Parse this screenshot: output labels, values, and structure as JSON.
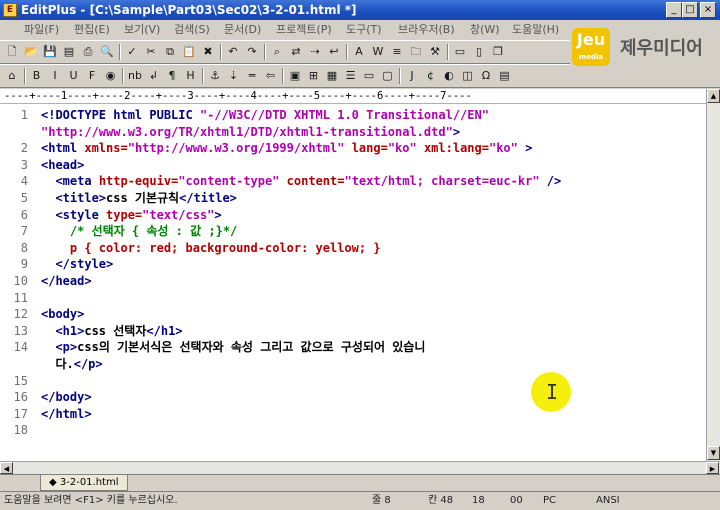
{
  "window": {
    "title": "EditPlus - [C:\\Sample\\Part03\\Sec02\\3-2-01.html *]",
    "min_label": "_",
    "max_label": "□",
    "close_label": "×"
  },
  "menu": [
    "파일(F)",
    "편집(E)",
    "보기(V)",
    "검색(S)",
    "문서(D)",
    "프로젝트(P)",
    "도구(T)",
    "브라우저(B)",
    "창(W)",
    "도움말(H)"
  ],
  "logo": {
    "mark": "Jeu",
    "mark_sub": "media",
    "name": "제우미디어"
  },
  "toolbar1": [
    {
      "name": "new-file-icon",
      "glyph": "🗋"
    },
    {
      "name": "open-icon",
      "glyph": "📂"
    },
    {
      "name": "save-icon",
      "glyph": "💾"
    },
    {
      "name": "save-all-icon",
      "glyph": "▤"
    },
    {
      "name": "print-icon",
      "glyph": "⎙"
    },
    {
      "name": "preview-icon",
      "glyph": "🔍"
    },
    {
      "name": "spell-check-icon",
      "glyph": "✓"
    },
    {
      "name": "cut-icon",
      "glyph": "✂"
    },
    {
      "name": "copy-icon",
      "glyph": "⧉"
    },
    {
      "name": "paste-icon",
      "glyph": "📋"
    },
    {
      "name": "delete-icon",
      "glyph": "✖"
    },
    {
      "name": "undo-icon",
      "glyph": "↶"
    },
    {
      "name": "redo-icon",
      "glyph": "↷"
    },
    {
      "name": "find-icon",
      "glyph": "⌕"
    },
    {
      "name": "replace-icon",
      "glyph": "⇄"
    },
    {
      "name": "goto-icon",
      "glyph": "⇢"
    },
    {
      "name": "word-wrap-icon",
      "glyph": "↩"
    },
    {
      "name": "font-icon",
      "glyph": "A"
    },
    {
      "name": "browser-icon",
      "glyph": "W"
    },
    {
      "name": "cliptext-icon",
      "glyph": "≡"
    },
    {
      "name": "directory-icon",
      "glyph": "🗀"
    },
    {
      "name": "user-tool-icon",
      "glyph": "⚒"
    },
    {
      "name": "tile-h-icon",
      "glyph": "▭"
    },
    {
      "name": "tile-v-icon",
      "glyph": "▯"
    },
    {
      "name": "cascade-icon",
      "glyph": "❐"
    }
  ],
  "toolbar2": [
    {
      "name": "quick-html-icon",
      "glyph": "⌂"
    },
    {
      "name": "bold-icon",
      "glyph": "B"
    },
    {
      "name": "italic-icon",
      "glyph": "I"
    },
    {
      "name": "underline-icon",
      "glyph": "U"
    },
    {
      "name": "font-tag-icon",
      "glyph": "F"
    },
    {
      "name": "color-icon",
      "glyph": "◉"
    },
    {
      "name": "nbsp-icon",
      "glyph": "nb"
    },
    {
      "name": "br-icon",
      "glyph": "↲"
    },
    {
      "name": "paragraph-icon",
      "glyph": "¶"
    },
    {
      "name": "heading-icon",
      "glyph": "H"
    },
    {
      "name": "anchor-icon",
      "glyph": "⚓"
    },
    {
      "name": "link-icon",
      "glyph": "⇣"
    },
    {
      "name": "hr-icon",
      "glyph": "═"
    },
    {
      "name": "comment-icon",
      "glyph": "⇦"
    },
    {
      "name": "image-icon",
      "glyph": "▣"
    },
    {
      "name": "table-icon",
      "glyph": "⊞"
    },
    {
      "name": "table-wizard-icon",
      "glyph": "▦"
    },
    {
      "name": "form-icon",
      "glyph": "☰"
    },
    {
      "name": "input-icon",
      "glyph": "▭"
    },
    {
      "name": "textarea-icon",
      "glyph": "▢"
    },
    {
      "name": "script-icon",
      "glyph": "J"
    },
    {
      "name": "style-icon",
      "glyph": "¢"
    },
    {
      "name": "color-picker-icon",
      "glyph": "◐"
    },
    {
      "name": "object-icon",
      "glyph": "◫"
    },
    {
      "name": "char-icon",
      "glyph": "Ω"
    },
    {
      "name": "html-preview-icon",
      "glyph": "▤"
    }
  ],
  "ruler": "----+----1----+----2----+----3----+----4----+----5----+----6----+----7----",
  "code": [
    {
      "num": "1",
      "parts": [
        [
          "tg",
          "<!DOCTYPE html PUBLIC "
        ],
        [
          "vl",
          "\"-//W3C//DTD XHTML 1.0 Transitional//EN\""
        ]
      ]
    },
    {
      "num": "",
      "parts": [
        [
          "vl",
          "\"http://www.w3.org/TR/xhtml1/DTD/xhtml1-transitional.dtd\""
        ],
        [
          "tg",
          ">"
        ]
      ]
    },
    {
      "num": "2",
      "parts": [
        [
          "tg",
          "<html "
        ],
        [
          "at",
          "xmlns="
        ],
        [
          "vl",
          "\"http://www.w3.org/1999/xhtml\""
        ],
        [
          "at",
          " lang="
        ],
        [
          "vl",
          "\"ko\""
        ],
        [
          "at",
          " xml:lang="
        ],
        [
          "vl",
          "\"ko\""
        ],
        [
          "tg",
          " >"
        ]
      ]
    },
    {
      "num": "3",
      "parts": [
        [
          "tg",
          "<head>"
        ]
      ]
    },
    {
      "num": "4",
      "parts": [
        [
          "tx",
          "  "
        ],
        [
          "tg",
          "<meta "
        ],
        [
          "at",
          "http-equiv="
        ],
        [
          "vl",
          "\"content-type\""
        ],
        [
          "at",
          " content="
        ],
        [
          "vl",
          "\"text/html; charset=euc-kr\""
        ],
        [
          "tg",
          " />"
        ]
      ]
    },
    {
      "num": "5",
      "parts": [
        [
          "tx",
          "  "
        ],
        [
          "tg",
          "<title>"
        ],
        [
          "tx",
          "css 기본규칙"
        ],
        [
          "tg",
          "</title>"
        ]
      ]
    },
    {
      "num": "6",
      "parts": [
        [
          "tx",
          "  "
        ],
        [
          "tg",
          "<style "
        ],
        [
          "at",
          "type="
        ],
        [
          "vl",
          "\"text/css\""
        ],
        [
          "tg",
          ">"
        ]
      ]
    },
    {
      "num": "7",
      "parts": [
        [
          "cm",
          "    /* 선택자 { 속성 : 값 ;}*/"
        ]
      ]
    },
    {
      "num": "8",
      "parts": [
        [
          "at",
          "    p { color: red; background-color: yellow; }"
        ]
      ]
    },
    {
      "num": "9",
      "parts": [
        [
          "tx",
          "  "
        ],
        [
          "tg",
          "</style>"
        ]
      ]
    },
    {
      "num": "10",
      "parts": [
        [
          "tg",
          "</head>"
        ]
      ]
    },
    {
      "num": "11",
      "parts": []
    },
    {
      "num": "12",
      "parts": [
        [
          "tg",
          "<body>"
        ]
      ]
    },
    {
      "num": "13",
      "parts": [
        [
          "tx",
          "  "
        ],
        [
          "tg",
          "<h1>"
        ],
        [
          "tx",
          "css 선택자"
        ],
        [
          "tg",
          "</h1>"
        ]
      ]
    },
    {
      "num": "14",
      "parts": [
        [
          "tx",
          "  "
        ],
        [
          "tg",
          "<p>"
        ],
        [
          "tx",
          "css의 기본서식은 선택자와 속성 그리고 값으로 구성되어 있습니"
        ]
      ]
    },
    {
      "num": "",
      "parts": [
        [
          "tx",
          "  다."
        ],
        [
          "tg",
          "</p>"
        ]
      ]
    },
    {
      "num": "15",
      "parts": []
    },
    {
      "num": "16",
      "parts": [
        [
          "tg",
          "</body>"
        ]
      ]
    },
    {
      "num": "17",
      "parts": [
        [
          "tg",
          "</html>"
        ]
      ]
    },
    {
      "num": "18",
      "parts": []
    }
  ],
  "file_tab": "3-2-01.html",
  "status": {
    "help": "도움말을 보려면 <F1> 키를 누르십시오.",
    "line": "줄 8",
    "col": "칸 48",
    "total": "18",
    "hex": "00",
    "format": "PC",
    "encoding": "ANSI"
  }
}
